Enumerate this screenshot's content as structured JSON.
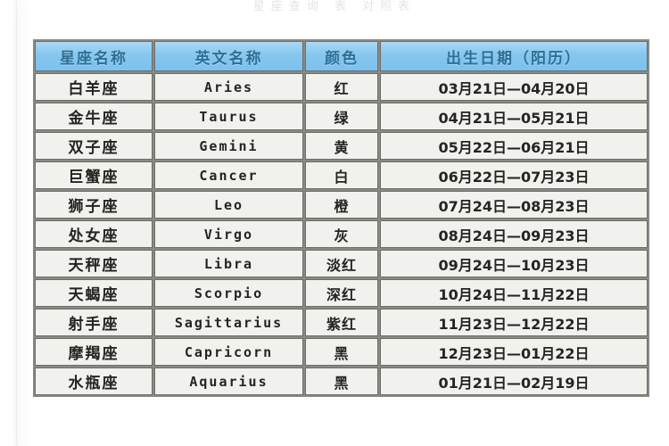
{
  "page": {
    "ghost_title": "星座查询 表 对照表",
    "background_color": "#ffffff"
  },
  "table": {
    "header_bg_color": "#86c6ef",
    "header_text_color": "#2d6f96",
    "cell_bg_color": "#f1f1ed",
    "border_color": "#6e6e68",
    "columns": [
      {
        "key": "cn_name",
        "label": "星座名称"
      },
      {
        "key": "en_name",
        "label": "英文名称"
      },
      {
        "key": "color",
        "label": "颜色"
      },
      {
        "key": "date_range",
        "label": "出生日期（阳历）"
      }
    ],
    "rows": [
      {
        "cn_name": "白羊座",
        "en_name": "Aries",
        "color": "红",
        "date_range": "03月21日—04月20日"
      },
      {
        "cn_name": "金牛座",
        "en_name": "Taurus",
        "color": "绿",
        "date_range": "04月21日—05月21日"
      },
      {
        "cn_name": "双子座",
        "en_name": "Gemini",
        "color": "黄",
        "date_range": "05月22日—06月21日"
      },
      {
        "cn_name": "巨蟹座",
        "en_name": "Cancer",
        "color": "白",
        "date_range": "06月22日—07月23日"
      },
      {
        "cn_name": "狮子座",
        "en_name": "Leo",
        "color": "橙",
        "date_range": "07月24日—08月23日"
      },
      {
        "cn_name": "处女座",
        "en_name": "Virgo",
        "color": "灰",
        "date_range": "08月24日—09月23日"
      },
      {
        "cn_name": "天秤座",
        "en_name": "Libra",
        "color": "淡红",
        "date_range": "09月24日—10月23日"
      },
      {
        "cn_name": "天蝎座",
        "en_name": "Scorpio",
        "color": "深红",
        "date_range": "10月24日—11月22日"
      },
      {
        "cn_name": "射手座",
        "en_name": "Sagittarius",
        "color": "紫红",
        "date_range": "11月23日—12月22日"
      },
      {
        "cn_name": "摩羯座",
        "en_name": "Capricorn",
        "color": "黑",
        "date_range": "12月23日—01月22日"
      },
      {
        "cn_name": "水瓶座",
        "en_name": "Aquarius",
        "color": "黑",
        "date_range": "01月21日—02月19日"
      }
    ]
  }
}
